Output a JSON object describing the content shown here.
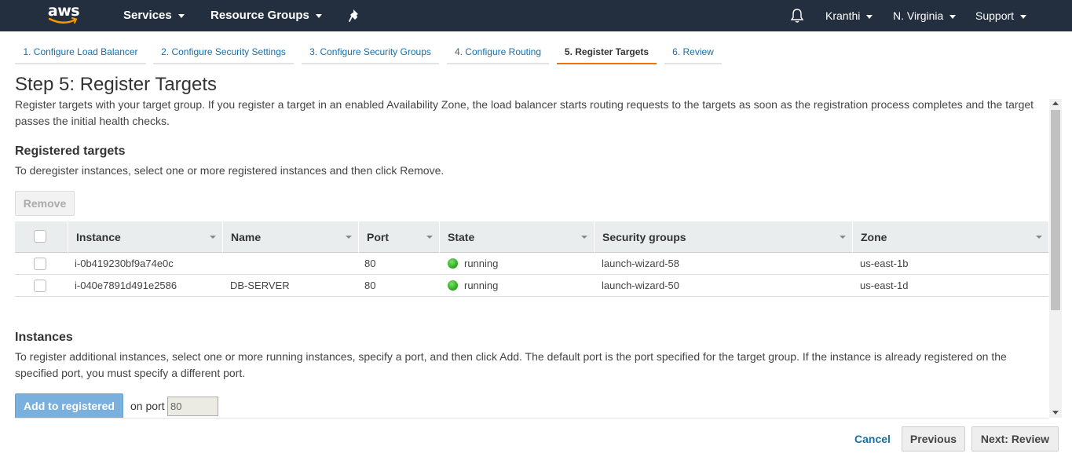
{
  "topnav": {
    "logo": "aws",
    "services": "Services",
    "resource_groups": "Resource Groups",
    "pin_icon": "pin-icon",
    "bell_icon": "bell-icon",
    "user": "Kranthi",
    "region": "N. Virginia",
    "support": "Support"
  },
  "tabs": [
    {
      "label": "1. Configure Load Balancer"
    },
    {
      "label": "2. Configure Security Settings"
    },
    {
      "label": "3. Configure Security Groups"
    },
    {
      "label": "4. Configure Routing"
    },
    {
      "label": "5. Register Targets",
      "active": true
    },
    {
      "label": "6. Review"
    }
  ],
  "page": {
    "title": "Step 5: Register Targets",
    "description": "Register targets with your target group. If you register a target in an enabled Availability Zone, the load balancer starts routing requests to the targets as soon as the registration process completes and the target passes the initial health checks."
  },
  "registered": {
    "heading": "Registered targets",
    "hint": "To deregister instances, select one or more registered instances and then click Remove.",
    "remove_label": "Remove",
    "columns": [
      "Instance",
      "Name",
      "Port",
      "State",
      "Security groups",
      "Zone"
    ],
    "rows": [
      {
        "instance": "i-0b419230bf9a74e0c",
        "name": "",
        "port": "80",
        "state": "running",
        "sg": "launch-wizard-58",
        "zone": "us-east-1b"
      },
      {
        "instance": "i-040e7891d491e2586",
        "name": "DB-SERVER",
        "port": "80",
        "state": "running",
        "sg": "launch-wizard-50",
        "zone": "us-east-1d"
      }
    ]
  },
  "instances": {
    "heading": "Instances",
    "hint": "To register additional instances, select one or more running instances, specify a port, and then click Add. The default port is the port specified for the target group. If the instance is already registered on the specified port, you must specify a different port.",
    "add_label": "Add to registered",
    "on_port_label": "on port",
    "port_value": "80"
  },
  "footer": {
    "cancel": "Cancel",
    "previous": "Previous",
    "next": "Next: Review"
  },
  "colors": {
    "nav_bg": "#232f3e",
    "link": "#1a6fa8",
    "active_tab": "#ec7211",
    "running": "#2eae1f"
  }
}
